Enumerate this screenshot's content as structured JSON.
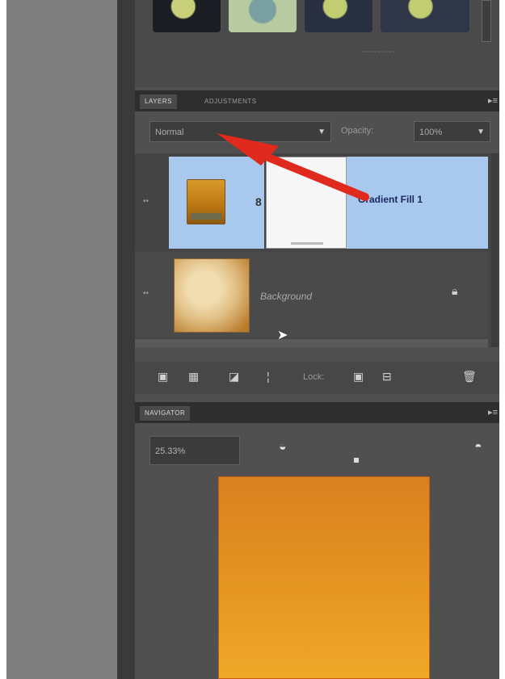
{
  "effects": {
    "more_label": "~~~~~~~~~"
  },
  "layers_panel": {
    "tabs": [
      "LAYERS",
      "ADJUSTMENTS"
    ],
    "menu_icon": "panel-menu-icon",
    "blend_mode": "Normal",
    "opacity_label": "Opacity:",
    "opacity_value": "100%",
    "layers": [
      {
        "name": "Gradient Fill 1",
        "selected": true,
        "thumbnail_color": "#c98a1e"
      },
      {
        "name": "Background",
        "selected": false,
        "locked": true
      }
    ],
    "lock_label": "Lock:"
  },
  "navigator": {
    "tab": "NAVIGATOR",
    "zoom": "25.33%"
  },
  "colors": {
    "selection": "#a8c8ee",
    "panel": "#505050",
    "annotation_arrow": "#e02a1e"
  }
}
